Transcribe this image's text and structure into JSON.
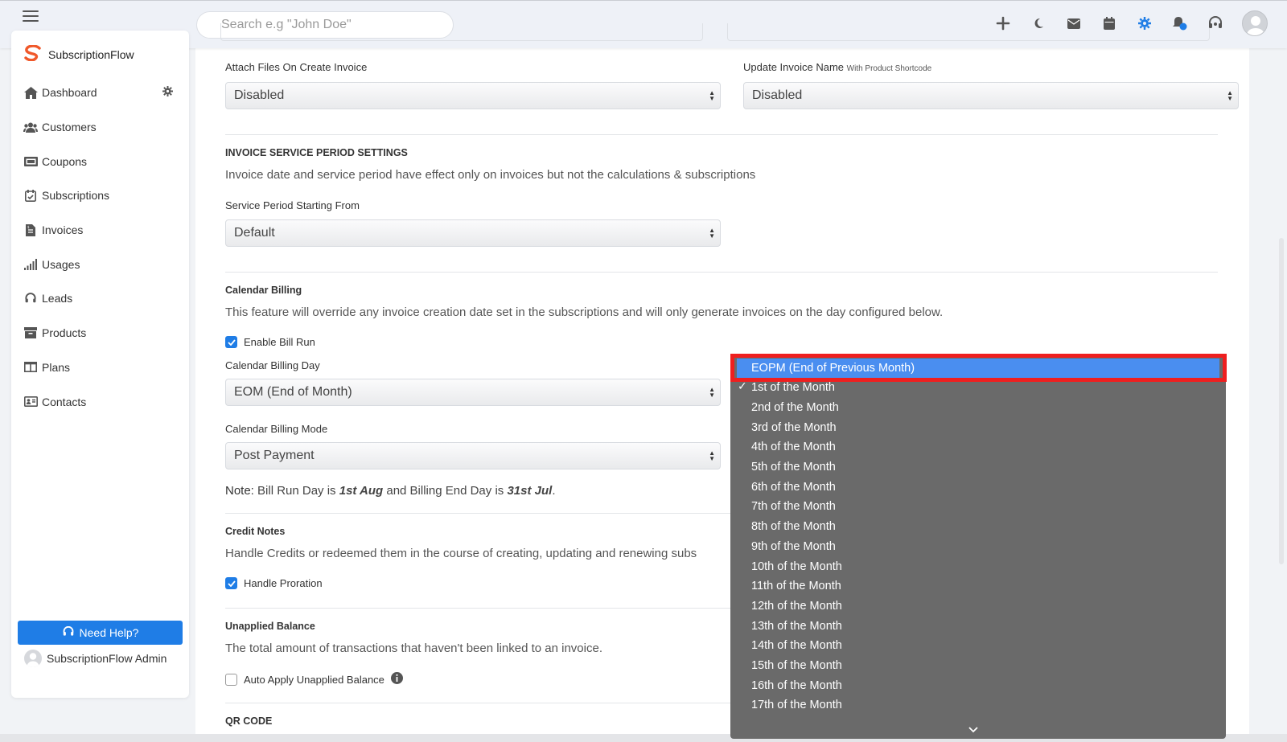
{
  "colors": {
    "accent": "#1f7de6",
    "highlight_border": "#ee1f1f",
    "dropdown_bg": "#6a6a6a",
    "selected_option_bg": "#4a8ef0"
  },
  "search": {
    "placeholder": "Search e.g \"John Doe\""
  },
  "topbar": {
    "icons": [
      "plus-icon",
      "moon-icon",
      "mail-icon",
      "calendar-icon",
      "gear-icon",
      "notification-bell-icon",
      "headset-icon",
      "user-avatar"
    ]
  },
  "sidebar": {
    "brand": "SubscriptionFlow",
    "items": [
      {
        "label": "Dashboard",
        "icon": "home-icon"
      },
      {
        "label": "Customers",
        "icon": "users-icon"
      },
      {
        "label": "Coupons",
        "icon": "coupon-icon"
      },
      {
        "label": "Subscriptions",
        "icon": "calendar-check-icon"
      },
      {
        "label": "Invoices",
        "icon": "invoice-icon"
      },
      {
        "label": "Usages",
        "icon": "signal-icon"
      },
      {
        "label": "Leads",
        "icon": "headset-icon"
      },
      {
        "label": "Products",
        "icon": "archive-icon"
      },
      {
        "label": "Plans",
        "icon": "columns-icon"
      },
      {
        "label": "Contacts",
        "icon": "address-card-icon"
      }
    ],
    "help_button": "Need Help?",
    "admin_name": "SubscriptionFlow Admin"
  },
  "form": {
    "attach_files": {
      "label": "Attach Files On Create Invoice",
      "value": "Disabled"
    },
    "update_invoice_name": {
      "label": "Update Invoice Name",
      "sublabel": "With Product Shortcode",
      "value": "Disabled"
    },
    "service_period": {
      "title": "INVOICE SERVICE PERIOD SETTINGS",
      "description": "Invoice date and service period have effect only on invoices but not the calculations & subscriptions",
      "field_label": "Service Period Starting From",
      "value": "Default"
    },
    "calendar_billing": {
      "title": "Calendar Billing",
      "description": "This feature will override any invoice creation date set in the subscriptions and will only generate invoices on the day configured below.",
      "enable_bill_run": "Enable Bill Run",
      "day_label": "Calendar Billing Day",
      "day_value": "EOM (End of Month)",
      "mode_label": "Calendar Billing Mode",
      "mode_value": "Post Payment",
      "note_prefix": "Note:",
      "note_part1": "Bill Run Day is",
      "note_bill_run_day": "1st Aug",
      "note_part2": "and Billing End Day is",
      "note_end_day": "31st Jul",
      "note_end": "."
    },
    "credit_notes": {
      "title": "Credit Notes",
      "description": "Handle Credits or redeemed them in the course of creating, updating and renewing subs",
      "handle_proration": "Handle Proration"
    },
    "unapplied_balance": {
      "title": "Unapplied Balance",
      "description": "The total amount of transactions that haven't been linked to an invoice.",
      "auto_apply": "Auto Apply Unapplied Balance"
    },
    "qr_code": {
      "title": "QR CODE"
    }
  },
  "dropdown": {
    "selected": "EOPM (End of Previous Month)",
    "checked": "1st of the Month",
    "options": [
      "2nd of the Month",
      "3rd of the Month",
      "4th of the Month",
      "5th of the Month",
      "6th of the Month",
      "7th of the Month",
      "8th of the Month",
      "9th of the Month",
      "10th of the Month",
      "11th of the Month",
      "12th of the Month",
      "13th of the Month",
      "14th of the Month",
      "15th of the Month",
      "16th of the Month",
      "17th of the Month"
    ]
  }
}
